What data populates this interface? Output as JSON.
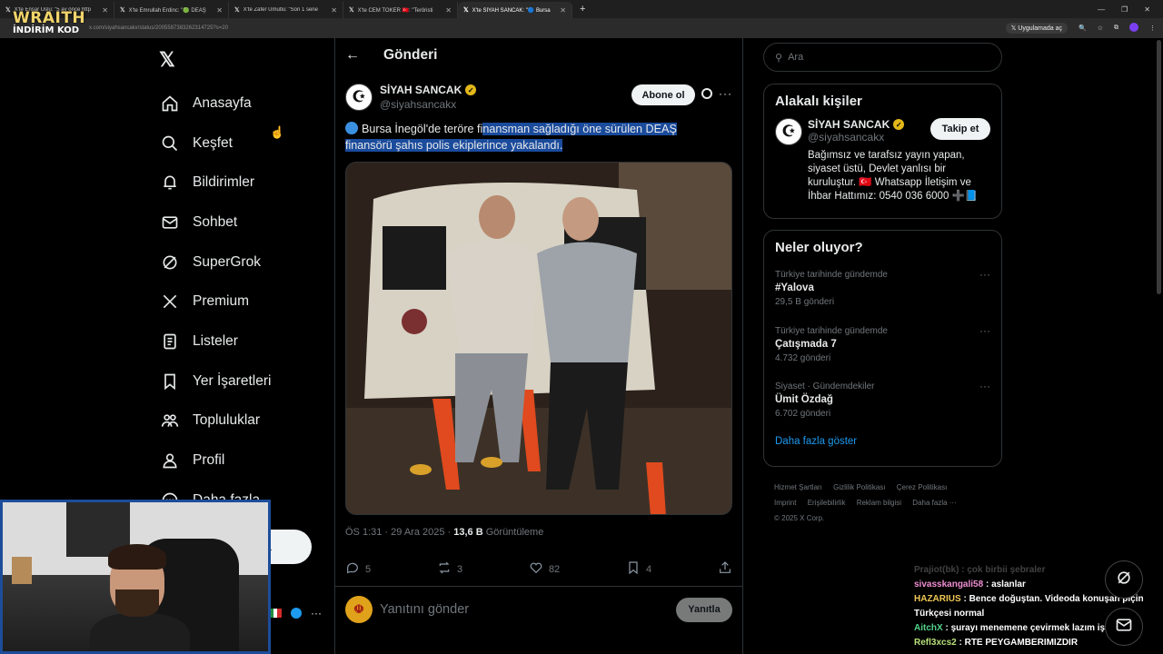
{
  "browser": {
    "tabs": [
      {
        "label": "X'te Ensar Uslu: \"5 ay önce http",
        "active": false
      },
      {
        "label": "X'te Emrullah Erdinc: \"🟢 DEAŞ",
        "active": false
      },
      {
        "label": "X'te Zafer Umutlu: \"Son 1 sene",
        "active": false
      },
      {
        "label": "X'te CEM TOKER 🇹🇷: \"Teröristi",
        "active": false
      },
      {
        "label": "X'te SİYAH SANCAK: \"🔵 Bursa",
        "active": true
      }
    ],
    "url": "x.com/siyahsancakx/status/2005587383262314725?s=20",
    "open_in_app": "Uygulamada aç"
  },
  "overlay": {
    "brand": "WRAITH",
    "subtitle": "İNDİRİM KOD"
  },
  "nav": {
    "items": [
      {
        "label": "Anasayfa",
        "icon": "home-icon"
      },
      {
        "label": "Keşfet",
        "icon": "search-icon"
      },
      {
        "label": "Bildirimler",
        "icon": "bell-icon"
      },
      {
        "label": "Sohbet",
        "icon": "mail-icon"
      },
      {
        "label": "SuperGrok",
        "icon": "grok-icon"
      },
      {
        "label": "Premium",
        "icon": "x-icon"
      },
      {
        "label": "Listeler",
        "icon": "list-icon"
      },
      {
        "label": "Yer İşaretleri",
        "icon": "bookmark-icon"
      },
      {
        "label": "Topluluklar",
        "icon": "community-icon"
      },
      {
        "label": "Profil",
        "icon": "person-icon"
      },
      {
        "label": "Daha fazla",
        "icon": "more-circle-icon"
      }
    ],
    "post_button_partial": "a"
  },
  "post": {
    "header_title": "Gönderi",
    "author_name": "SİYAH SANCAK",
    "author_handle": "@siyahsancakx",
    "subscribe_label": "Abone ol",
    "text_plain": "Bursa İnegöl'de teröre fi",
    "text_highlighted": "nansman sağladığı öne sürülen DEAŞ finansörü şahıs polis ekiplerince yakalandı.",
    "timestamp": "ÖS 1:31 · 29 Ara 2025 · ",
    "views": "13,6 B",
    "views_label": " Görüntüleme",
    "replies": "5",
    "reposts": "3",
    "likes": "82",
    "bookmarks": "4",
    "reply_placeholder": "Yanıtını gönder",
    "reply_button": "Yanıtla"
  },
  "sidebar": {
    "search_placeholder": "Ara",
    "related_title": "Alakalı kişiler",
    "person_name": "SİYAH SANCAK",
    "person_handle": "@siyahsancakx",
    "follow_label": "Takip et",
    "person_bio": "Bağımsız ve tarafsız yayın yapan, siyaset üstü, Devlet yanlısı bir kuruluştur. 🇹🇷 Whatsapp İletişim ve İhbar Hattımız: 0540 036 6000 ➕📘",
    "trends_title": "Neler oluyor?",
    "trends": [
      {
        "category": "Türkiye tarihinde gündemde",
        "name": "#Yalova",
        "count": "29,5 B gönderi"
      },
      {
        "category": "Türkiye tarihinde gündemde",
        "name": "Çatışmada 7",
        "count": "4.732 gönderi"
      },
      {
        "category": "Siyaset · Gündemdekiler",
        "name": "Ümit Özdağ",
        "count": "6.702 gönderi"
      }
    ],
    "show_more": "Daha fazla göster",
    "footer": [
      "Hizmet Şartları",
      "Gizlilik Politikası",
      "Çerez Politikası",
      "Imprint",
      "Erişilebilirlik",
      "Reklam bilgisi",
      "Daha fazla ···",
      "© 2025 X Corp."
    ]
  },
  "chat": [
    {
      "user": "sivasskangali58",
      "msg": "aslanlar"
    },
    {
      "user": "HAZARIUS",
      "msg": "Bence doğuştan. Videoda konuşan piçin Türkçesi normal"
    },
    {
      "user": "AitchX",
      "msg": "şurayı menemene çevirmek lazım işte de"
    },
    {
      "user": "Refl3xcs2",
      "msg": "RTE PEYGAMBERIMIZDIR"
    }
  ],
  "chat_faded": "Prajiot(bk) : çok birbii şebraler",
  "colors": {
    "accent": "#1d9bf0",
    "bg": "#000000",
    "border": "#2f3336",
    "highlight": "#1a4b9c",
    "verified_gold": "#e2b719"
  }
}
